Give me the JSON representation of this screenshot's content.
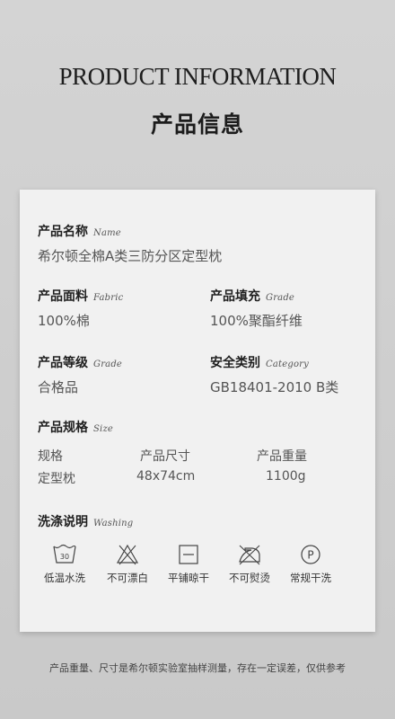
{
  "header": {
    "title_en": "PRODUCT INFORMATION",
    "title_cn": "产品信息"
  },
  "fields": {
    "name": {
      "label": "产品名称",
      "script": "Name",
      "value": "希尔顿全棉A类三防分区定型枕"
    },
    "fabric": {
      "label": "产品面料",
      "script": "Fabric",
      "value": "100%棉"
    },
    "filling": {
      "label": "产品填充",
      "script": "Grade",
      "value": "100%聚酯纤维"
    },
    "grade": {
      "label": "产品等级",
      "script": "Grade",
      "value": "合格品"
    },
    "safety": {
      "label": "安全类别",
      "script": "Category",
      "value": "GB18401-2010 B类"
    }
  },
  "spec": {
    "label": "产品规格",
    "script": "Size",
    "headers": [
      "规格",
      "产品尺寸",
      "产品重量"
    ],
    "row": [
      "定型枕",
      "48x74cm",
      "1100g"
    ]
  },
  "washing": {
    "label": "洗涤说明",
    "script": "Washing",
    "items": [
      {
        "icon": "wash-30-icon",
        "symbol_text": "30",
        "label": "低温水洗"
      },
      {
        "icon": "no-bleach-icon",
        "label": "不可漂白"
      },
      {
        "icon": "dry-flat-icon",
        "label": "平铺晾干"
      },
      {
        "icon": "no-iron-icon",
        "label": "不可熨烫"
      },
      {
        "icon": "dry-clean-icon",
        "symbol_text": "P",
        "label": "常规干洗"
      }
    ]
  },
  "footnote": "产品重量、尺寸是希尔顿实验室抽样测量，存在一定误差，仅供参考"
}
